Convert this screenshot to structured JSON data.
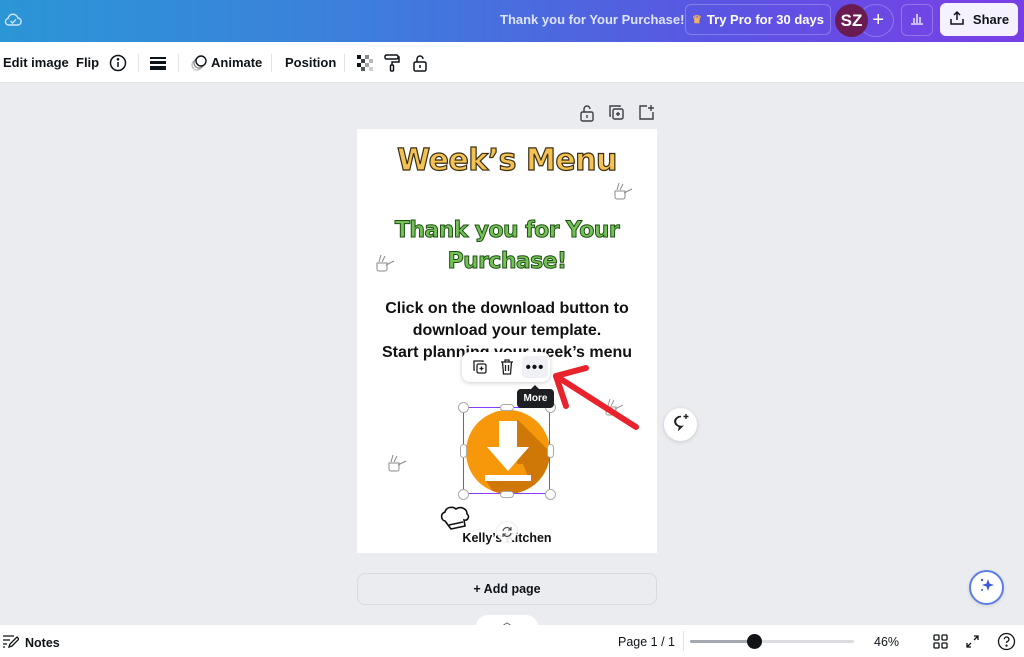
{
  "topbar": {
    "cloud_icon": "cloud-check-icon",
    "title": "Thank you for Your Purchase!",
    "try_pro_label": "Try Pro for 30 days",
    "try_pro_icon": "crown-icon",
    "avatar_initials": "SZ",
    "add_collaborator_label": "+",
    "insights_icon": "bar-chart-icon",
    "share_label": "Share",
    "share_icon": "upload-icon",
    "gradient_colors": [
      "#2b96d6",
      "#5a55e2",
      "#7a3ee6"
    ]
  },
  "toolbar": {
    "edit_image_label": "Edit image",
    "flip_label": "Flip",
    "info_icon": "info-icon",
    "border_icon": "line-weight-icon",
    "animate_label": "Animate",
    "position_label": "Position",
    "transparency_icon": "transparency-icon",
    "paint_icon": "paint-roller-icon",
    "lock_icon": "unlock-icon"
  },
  "page_actions": [
    "unlock-icon",
    "duplicate-page-icon",
    "add-page-icon"
  ],
  "canvas": {
    "heading": "Week’s Menu",
    "subheading": "Thank you for Your Purchase!",
    "instructions": [
      "Click on the download button to",
      "download your template.",
      "Start planning your week’s menu"
    ],
    "footer": "Kelly’s Kitchen",
    "heading_color": "#f4c253",
    "subheading_color": "#74c257",
    "download_icon_color": "#f7970a"
  },
  "context_menu": {
    "duplicate_icon": "duplicate-icon",
    "delete_icon": "trash-icon",
    "more_label": "•••",
    "tooltip": "More"
  },
  "add_page_label": "+ Add page",
  "bottombar": {
    "notes_label": "Notes",
    "page_indicator": "Page 1 / 1",
    "zoom_value_percent": 46,
    "zoom_label": "46%",
    "zoom_slider_fraction": 0.39
  }
}
